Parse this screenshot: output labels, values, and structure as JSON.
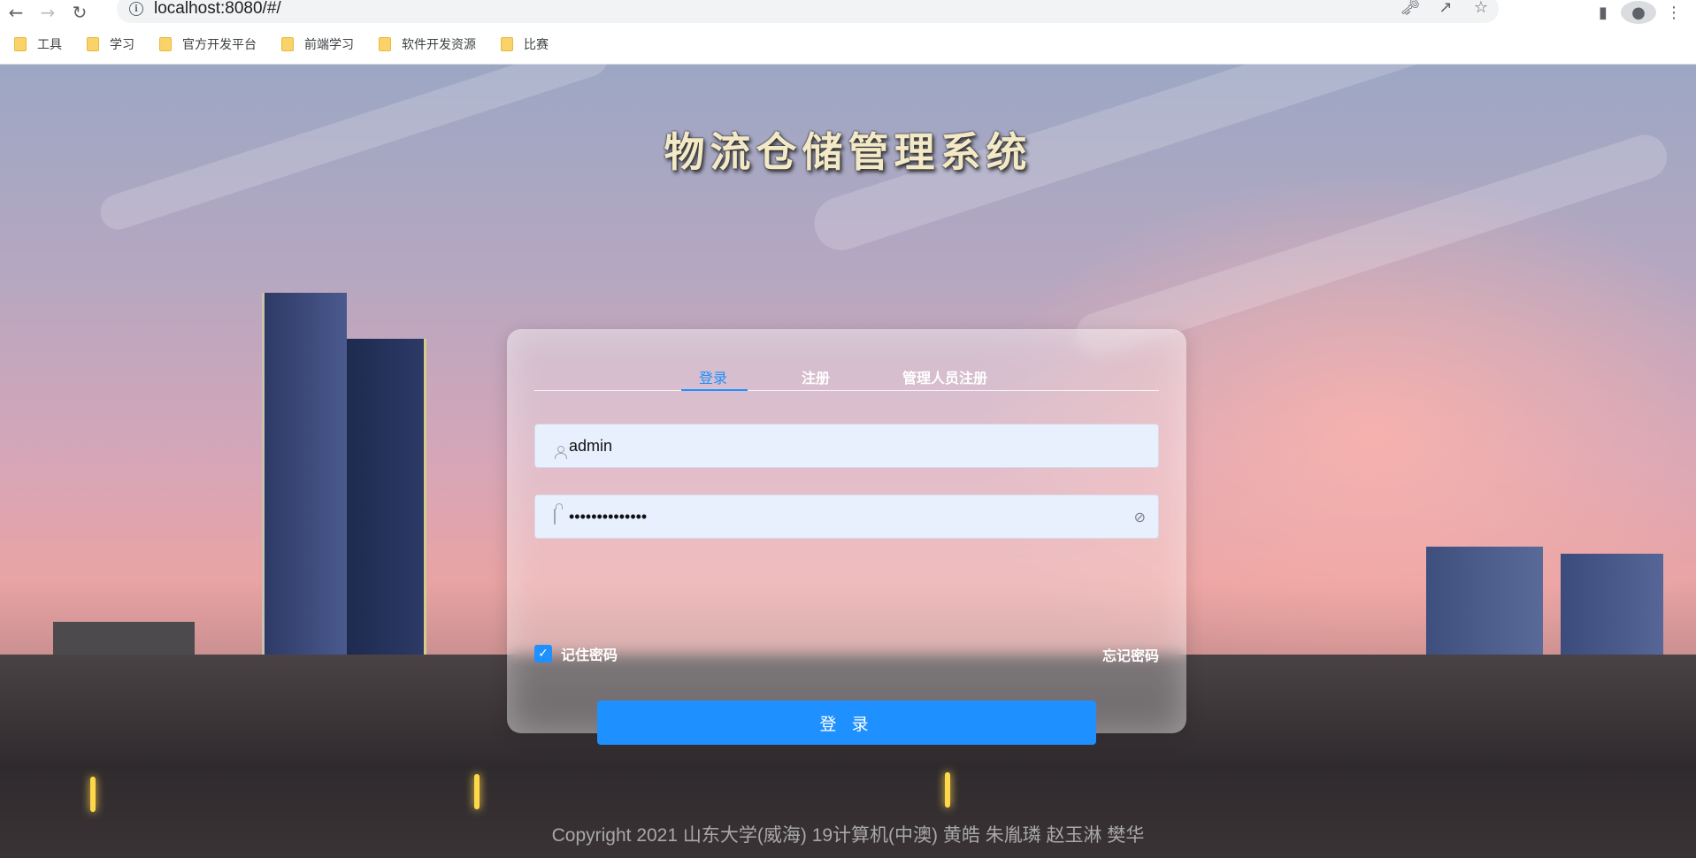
{
  "browser": {
    "url": "localhost:8080/#/",
    "bookmarks": [
      "工具",
      "学习",
      "官方开发平台",
      "前端学习",
      "软件开发资源",
      "比赛"
    ]
  },
  "page": {
    "title": "物流仓储管理系统",
    "tabs": [
      "登录",
      "注册",
      "管理人员注册"
    ],
    "active_tab": "登录",
    "username_value": "admin",
    "password_value": "••••••••••••••",
    "remember_label": "记住密码",
    "remember_checked": true,
    "forgot_label": "忘记密码",
    "login_button": "登 录",
    "copyright": "Copyright 2021 山东大学(威海) 19计算机(中澳) 黄皓 朱胤璘 赵玉淋 樊华"
  },
  "colors": {
    "accent": "#1e90ff",
    "input_bg": "#e8f0fe"
  },
  "icons": {
    "back": "back-arrow-icon",
    "forward": "forward-arrow-icon",
    "reload": "reload-icon",
    "site_info": "info-icon",
    "key": "key-icon",
    "share": "share-icon",
    "star": "star-icon",
    "sidepanel": "side-panel-icon",
    "profile": "profile-icon",
    "menu": "kebab-menu-icon",
    "user": "user-icon",
    "lock": "lock-icon",
    "eye": "eye-slash-icon",
    "check": "check-icon",
    "folder": "folder-icon"
  }
}
